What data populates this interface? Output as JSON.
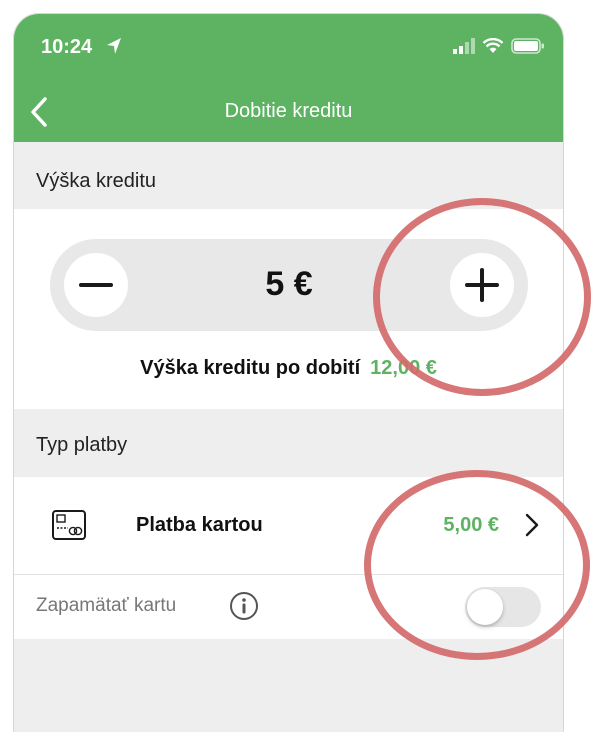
{
  "status_bar": {
    "time": "10:24"
  },
  "nav": {
    "title": "Dobitie kreditu"
  },
  "credit": {
    "section_label": "Výška kreditu",
    "amount": "5 €",
    "after_label": "Výška kreditu po dobití",
    "after_value": "12,00 €"
  },
  "payment": {
    "section_label": "Typ platby",
    "method_label": "Platba kartou",
    "method_amount": "5,00 €",
    "remember_label": "Zapamätať kartu",
    "remember_enabled": false
  },
  "colors": {
    "brand_green": "#5db362",
    "annotation_red": "#d46a6a"
  },
  "icons": [
    "location-arrow-icon",
    "signal-icon",
    "wifi-icon",
    "battery-icon",
    "back-chevron-icon",
    "minus-icon",
    "plus-icon",
    "credit-card-icon",
    "chevron-right-icon",
    "info-icon"
  ]
}
